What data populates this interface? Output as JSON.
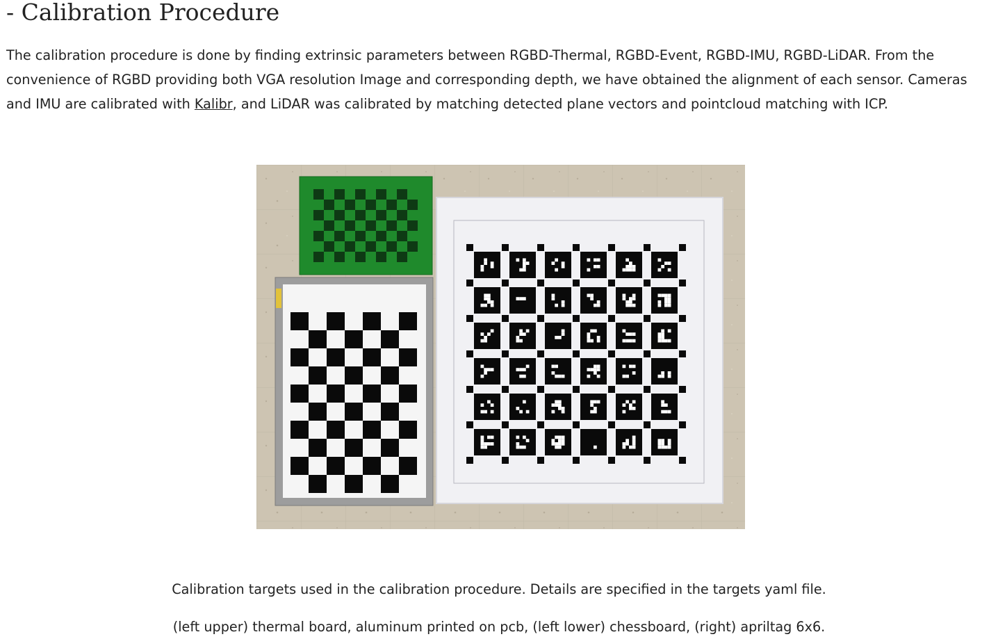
{
  "section": {
    "title": "- Calibration Procedure"
  },
  "paragraph": {
    "text_before_link": "The calibration procedure is done by finding extrinsic parameters between RGBD-Thermal, RGBD-Event, RGBD-IMU, RGBD-LiDAR. From the convenience of RGBD providing both VGA resolution Image and corresponding depth, we have obtained the alignment of each sensor. Cameras and IMU are calibrated with ",
    "link_text": "Kalibr",
    "text_after_link": ", and LiDAR was calibrated by matching detected plane vectors and pointcloud matching with ICP."
  },
  "figure": {
    "caption_line1": "Calibration targets used in the calibration procedure. Details are specified in the targets yaml file.",
    "caption_line2": "(left upper) thermal board, aluminum printed on pcb, (left lower) chessboard, (right) apriltag 6x6.",
    "colors": {
      "floor": "#cfc6b4",
      "pcb_green": "#1f8a2c",
      "frame_gray": "#9b9b9b",
      "paper": "#f4f4f6",
      "ink": "#0a0a0a"
    },
    "boards": {
      "thermal_checker": {
        "cols": 10,
        "rows": 7
      },
      "chessboard": {
        "cols": 7,
        "rows": 10
      },
      "apriltag": {
        "cols": 6,
        "rows": 6
      }
    }
  }
}
